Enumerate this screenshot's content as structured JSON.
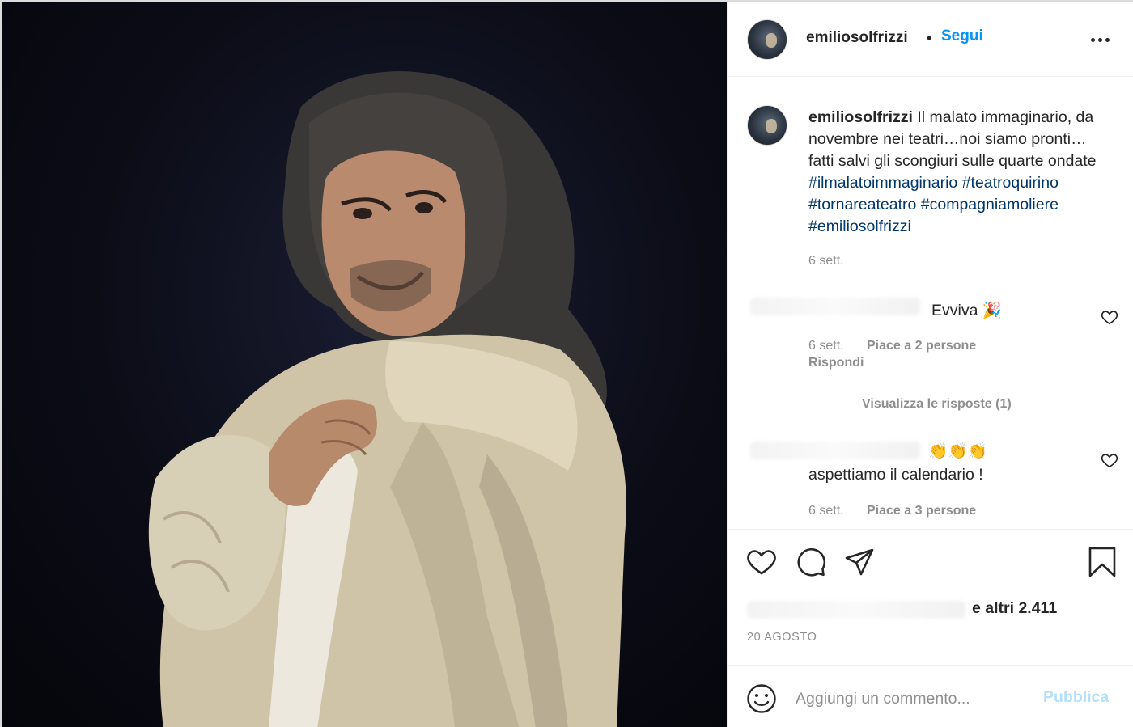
{
  "post": {
    "username": "emiliosolfrizzi",
    "separator": "•",
    "follow_label": "Segui",
    "more_icon": "more-horizontal-icon"
  },
  "caption": {
    "username": "emiliosolfrizzi",
    "text": "Il malato immaginario, da novembre nei teatri…noi siamo pronti…fatti salvi gli scongiuri sulle quarte ondate",
    "hashtags": [
      "#ilmalatoimmaginario",
      "#teatroquirino",
      "#tornareateatro",
      "#compagniamoliere",
      "#emiliosolfrizzi"
    ],
    "time": "6 sett."
  },
  "comments": [
    {
      "text": "Evviva 🎉",
      "time": "6 sett.",
      "likes": "Piace a 2 persone",
      "reply": "Rispondi",
      "view_replies": "Visualizza le risposte (1)"
    },
    {
      "text_line1": "👏👏👏",
      "text_line2": "aspettiamo il calendario !",
      "time": "6 sett.",
      "likes": "Piace a 3 persone"
    }
  ],
  "actions": {
    "icons": [
      "heart-icon",
      "comment-icon",
      "share-icon",
      "bookmark-icon"
    ]
  },
  "likes_summary": "e altri 2.411",
  "post_date": "20 AGOSTO",
  "add_comment": {
    "placeholder": "Aggiungi un commento...",
    "post_label": "Pubblica"
  },
  "colors": {
    "accent": "#0095f6",
    "hashtag": "#00376b",
    "muted": "#8e8e8e",
    "post_disabled": "#b2dffc"
  }
}
